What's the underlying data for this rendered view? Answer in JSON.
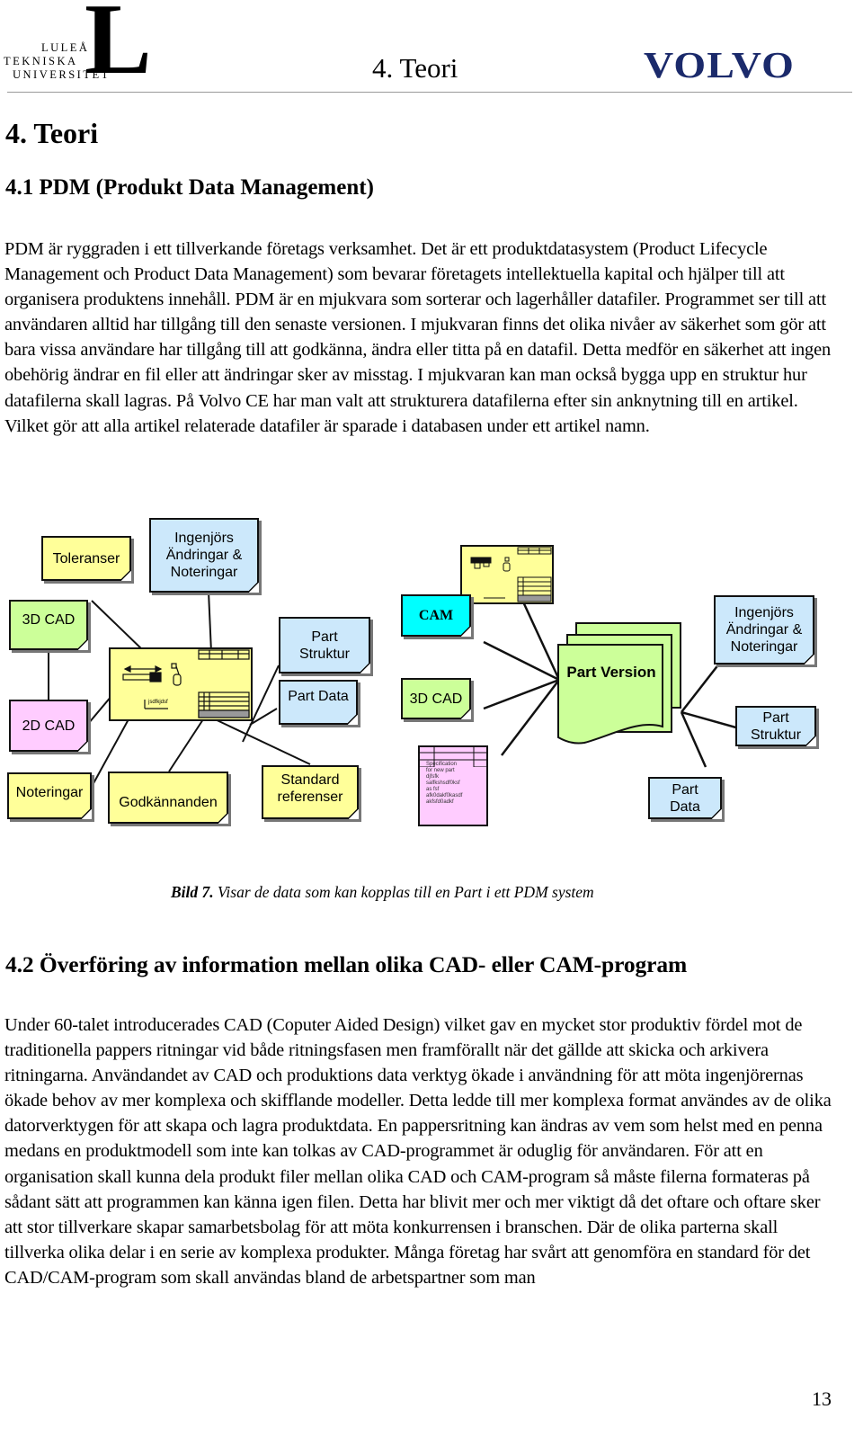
{
  "header": {
    "logo_left": {
      "lines": [
        "LULEÅ",
        "TEKNISKA",
        "UNIVERSITET"
      ],
      "mark": "L"
    },
    "chapter_title": "4. Teori",
    "logo_right": "VOLVO",
    "brand_color": "#1b2a6b"
  },
  "section": {
    "title": "4. Teori",
    "subsection_1": {
      "title": "4.1 PDM (Produkt Data Management)",
      "paragraph": "PDM är ryggraden i ett tillverkande företags verksamhet. Det är ett produktdatasystem (Product Lifecycle Management och Product Data Management) som bevarar företagets intellektuella kapital och hjälper till att organisera produktens innehåll. PDM är en mjukvara som sorterar och lagerhåller datafiler. Programmet ser till att användaren alltid har tillgång till den senaste versionen. I mjukvaran finns det olika nivåer av säkerhet som gör att bara vissa användare har tillgång till att godkänna, ändra eller titta på en datafil. Detta medför en säkerhet att ingen obehörig ändrar en fil eller att ändringar sker av misstag. I mjukvaran kan man också bygga upp en struktur hur datafilerna skall lagras. På Volvo CE har man valt att strukturera datafilerna efter sin anknytning till en artikel. Vilket gör att alla artikel relaterade datafiler är sparade i databasen under ett artikel namn."
    },
    "subsection_2": {
      "title": "4.2 Överföring av information mellan olika CAD- eller CAM-program",
      "paragraph": "Under 60-talet introducerades CAD (Coputer Aided Design) vilket gav en mycket stor produktiv fördel mot de traditionella pappers ritningar vid både ritningsfasen men framförallt när det gällde att skicka och arkivera ritningarna. Användandet av CAD och produktions data verktyg ökade i användning för att möta ingenjörernas ökade behov av mer komplexa och skifflande modeller. Detta ledde till mer komplexa format användes av de olika datorverktygen för att skapa och lagra produktdata. En pappersritning kan ändras av vem som helst med en penna medans en produktmodell som inte kan tolkas av CAD-programmet är oduglig för användaren. För att en organisation skall kunna dela produkt filer mellan olika CAD och CAM-program så måste filerna formateras på sådant sätt att programmen kan känna igen filen. Detta har blivit mer och mer viktigt då det oftare och oftare sker att stor tillverkare skapar samarbetsbolag för att möta konkurrensen i branschen. Där de olika parterna skall tillverka olika delar i en serie av komplexa produkter. Många företag har svårt att genomföra en standard för det CAD/CAM-program som skall användas bland de arbetspartner som man"
    }
  },
  "diagram": {
    "left_group": {
      "notes": {
        "toleranser": "Toleranser",
        "ingenjors_1": "Ingenjörs Ändringar & Noteringar",
        "cad3d": "3D CAD",
        "part_struktur": "Part Struktur",
        "part_data": "Part Data",
        "cad2d": "2D CAD",
        "noteringar": "Noteringar",
        "godkannanden": "Godkännanden",
        "standard": "Standard referenser"
      },
      "drawing_scribble": "jsdfkjdsf"
    },
    "right_group": {
      "center": "Part Version",
      "notes": {
        "cam": "CAM",
        "cad3d": "3D CAD",
        "ingenjors": "Ingenjörs Ändringar & Noteringar",
        "part_struktur": "Part Struktur",
        "part_data": "Part Data"
      },
      "spec_lines": [
        "Specification",
        "for new part",
        "djfsfk",
        "salfkshsdf0ksf",
        "as fsf",
        "afk0dakf0kasdf",
        "akfsfd0adkf"
      ]
    },
    "colors": {
      "yellow": "#ffff99",
      "blue": "#cce8fb",
      "green": "#ccff99",
      "pink": "#ffccff",
      "cyan": "#00ffff"
    }
  },
  "caption": {
    "label": "Bild 7.",
    "text": " Visar de data som kan kopplas till en Part i ett PDM system"
  },
  "page_number": "13"
}
